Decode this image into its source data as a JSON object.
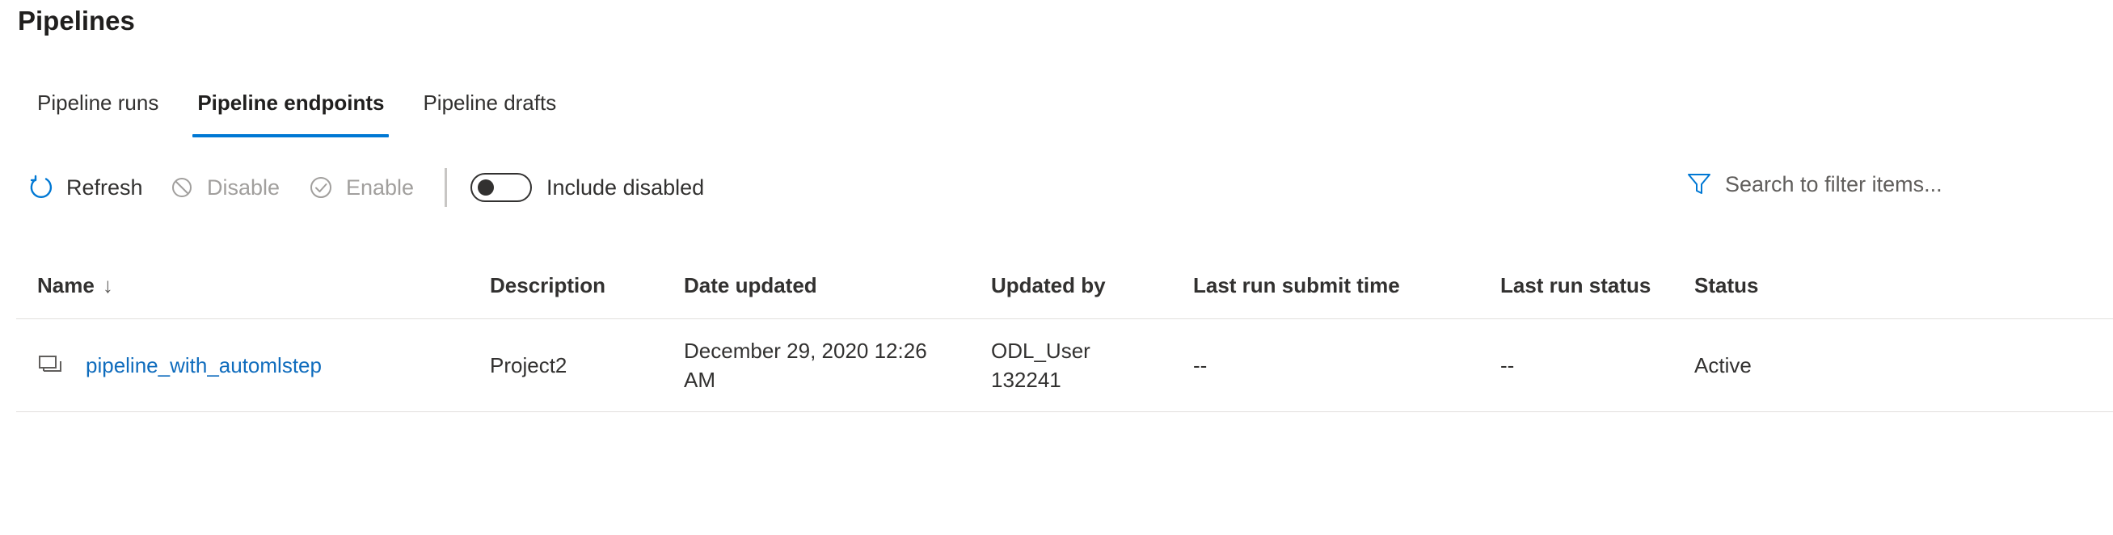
{
  "page": {
    "title": "Pipelines"
  },
  "tabs": [
    {
      "label": "Pipeline runs",
      "active": false
    },
    {
      "label": "Pipeline endpoints",
      "active": true
    },
    {
      "label": "Pipeline drafts",
      "active": false
    }
  ],
  "toolbar": {
    "refresh_label": "Refresh",
    "refresh_icon": "refresh-icon",
    "disable_label": "Disable",
    "disable_icon": "block-icon",
    "enable_label": "Enable",
    "enable_icon": "check-circle-icon",
    "include_disabled_label": "Include disabled",
    "include_disabled_on": false,
    "search_placeholder": "Search to filter items...",
    "search_icon": "filter-icon"
  },
  "table": {
    "columns": [
      "Name",
      "Description",
      "Date updated",
      "Updated by",
      "Last run submit time",
      "Last run status",
      "Status"
    ],
    "sort_indicator": "↓",
    "rows": [
      {
        "icon": "pipeline-icon",
        "name": "pipeline_with_automlstep",
        "description": "Project2",
        "date_updated": "December 29, 2020 12:26 AM",
        "updated_by": "ODL_User 132241",
        "last_run_submit_time": "--",
        "last_run_status": "--",
        "status": "Active"
      }
    ]
  },
  "colors": {
    "accent": "#0078d4",
    "link": "#0f6cbd",
    "text": "#323130",
    "disabled_text": "#a19f9d",
    "divider": "#e1dfdd"
  }
}
